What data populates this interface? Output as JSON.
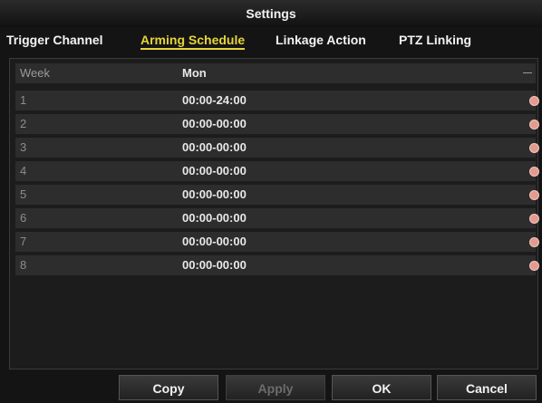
{
  "window": {
    "title": "Settings"
  },
  "tabs": [
    {
      "label": "Trigger Channel",
      "active": false
    },
    {
      "label": "Arming Schedule",
      "active": true
    },
    {
      "label": "Linkage Action",
      "active": false
    },
    {
      "label": "PTZ Linking",
      "active": false
    }
  ],
  "week": {
    "label": "Week",
    "value": "Mon"
  },
  "schedule": [
    {
      "index": "1",
      "time": "00:00-24:00"
    },
    {
      "index": "2",
      "time": "00:00-00:00"
    },
    {
      "index": "3",
      "time": "00:00-00:00"
    },
    {
      "index": "4",
      "time": "00:00-00:00"
    },
    {
      "index": "5",
      "time": "00:00-00:00"
    },
    {
      "index": "6",
      "time": "00:00-00:00"
    },
    {
      "index": "7",
      "time": "00:00-00:00"
    },
    {
      "index": "8",
      "time": "00:00-00:00"
    }
  ],
  "buttons": {
    "copy": "Copy",
    "apply": "Apply",
    "ok": "OK",
    "cancel": "Cancel"
  },
  "colors": {
    "accent": "#e6d43a",
    "edit_icon": "#e39b8f"
  }
}
